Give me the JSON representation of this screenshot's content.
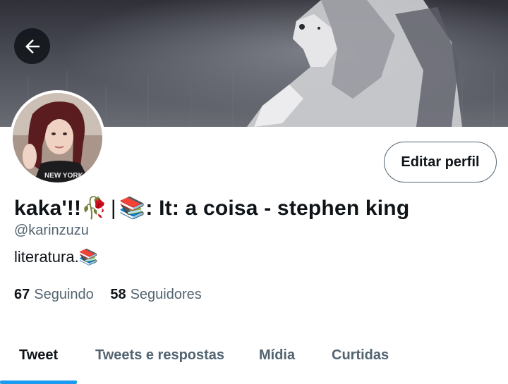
{
  "header": {
    "back_icon": "arrow-left-icon",
    "banner_description_icon": "wolf-banner-image"
  },
  "profile": {
    "display_name_part1": "kaka'!!🥀",
    "separator": "|",
    "display_name_part2": "📚: It: a coisa - stephen king",
    "handle": "@karinzuzu",
    "bio": "literatura.📚",
    "edit_label": "Editar perfil"
  },
  "stats": {
    "following_count": "67",
    "following_label": "Seguindo",
    "followers_count": "58",
    "followers_label": "Seguidores"
  },
  "tabs": [
    {
      "label": "Tweet",
      "active": true
    },
    {
      "label": "Tweets e respostas",
      "active": false
    },
    {
      "label": "Mídia",
      "active": false
    },
    {
      "label": "Curtidas",
      "active": false
    }
  ],
  "colors": {
    "accent": "#1d9bf0",
    "text_primary": "#0f1419",
    "text_secondary": "#536471"
  }
}
